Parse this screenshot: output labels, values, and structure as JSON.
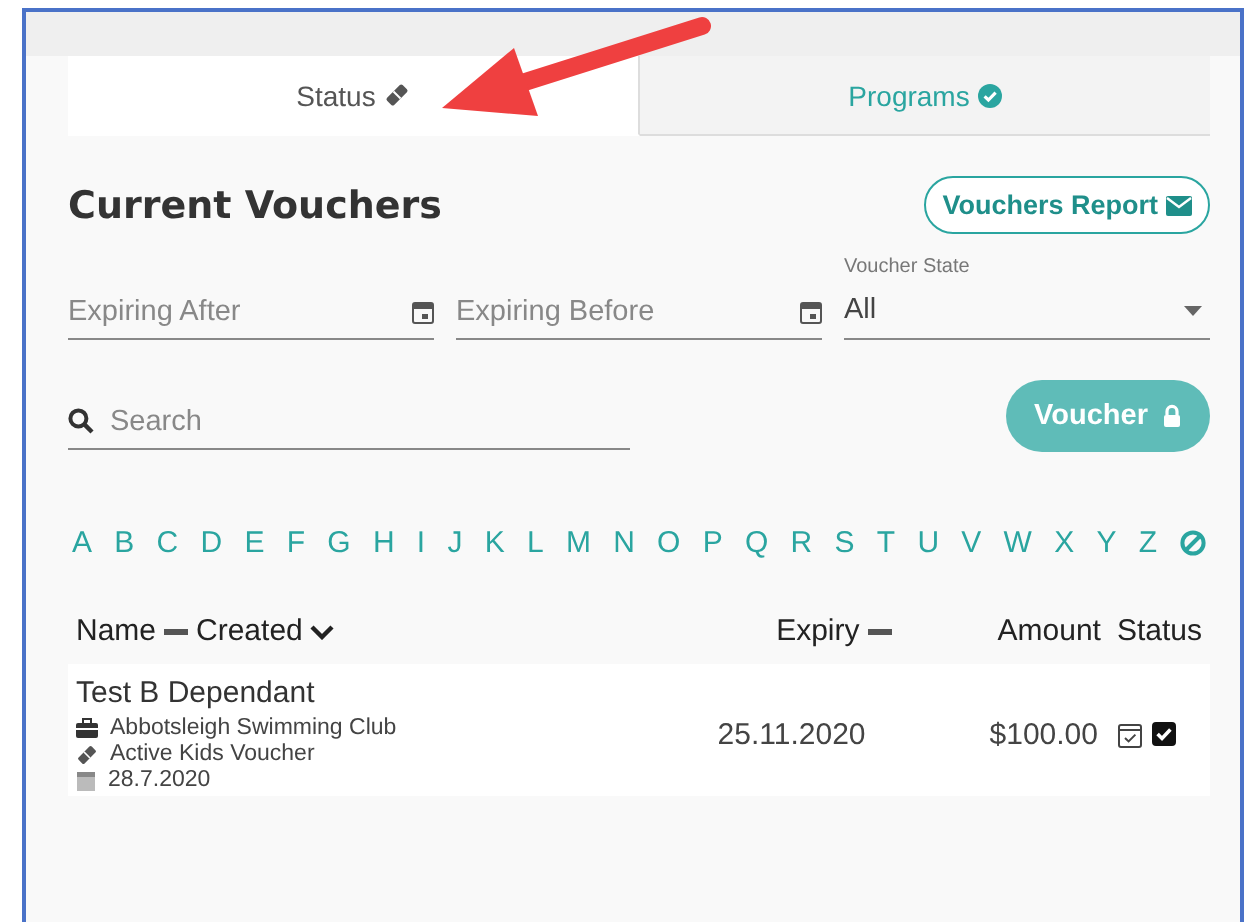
{
  "tabs": [
    {
      "label": "Status",
      "kind": "ticket",
      "selected": true
    },
    {
      "label": "Programs",
      "kind": "done",
      "selected": false
    }
  ],
  "title": "Current Vouchers",
  "report_button": {
    "label": "Vouchers Report"
  },
  "filters": [
    {
      "kind": "date",
      "placeholder": "Expiring After"
    },
    {
      "kind": "date",
      "placeholder": "Expiring Before"
    },
    {
      "kind": "select",
      "label": "Voucher State",
      "value": "All"
    }
  ],
  "search": {
    "placeholder": "Search"
  },
  "voucher_button": {
    "label": "Voucher",
    "disabled": true
  },
  "letters": [
    "A",
    "B",
    "C",
    "D",
    "E",
    "F",
    "G",
    "H",
    "I",
    "J",
    "K",
    "L",
    "M",
    "N",
    "O",
    "P",
    "Q",
    "R",
    "S",
    "T",
    "U",
    "V",
    "W",
    "X",
    "Y",
    "Z"
  ],
  "columns": [
    {
      "label": "Name",
      "kind": "sortable"
    },
    {
      "label": "Created",
      "kind": "sorted"
    },
    {
      "label": "Expiry",
      "kind": "sortable"
    },
    {
      "label": "Amount",
      "kind": "plain"
    },
    {
      "label": "Status",
      "kind": "plain"
    }
  ],
  "rows": [
    {
      "name": "Test B Dependant",
      "club": "Abbotsleigh Swimming Club",
      "voucher": "Active Kids Voucher",
      "created": "28.7.2020",
      "expiry": "25.11.2020",
      "amount": "$100.00",
      "checked": true
    }
  ]
}
